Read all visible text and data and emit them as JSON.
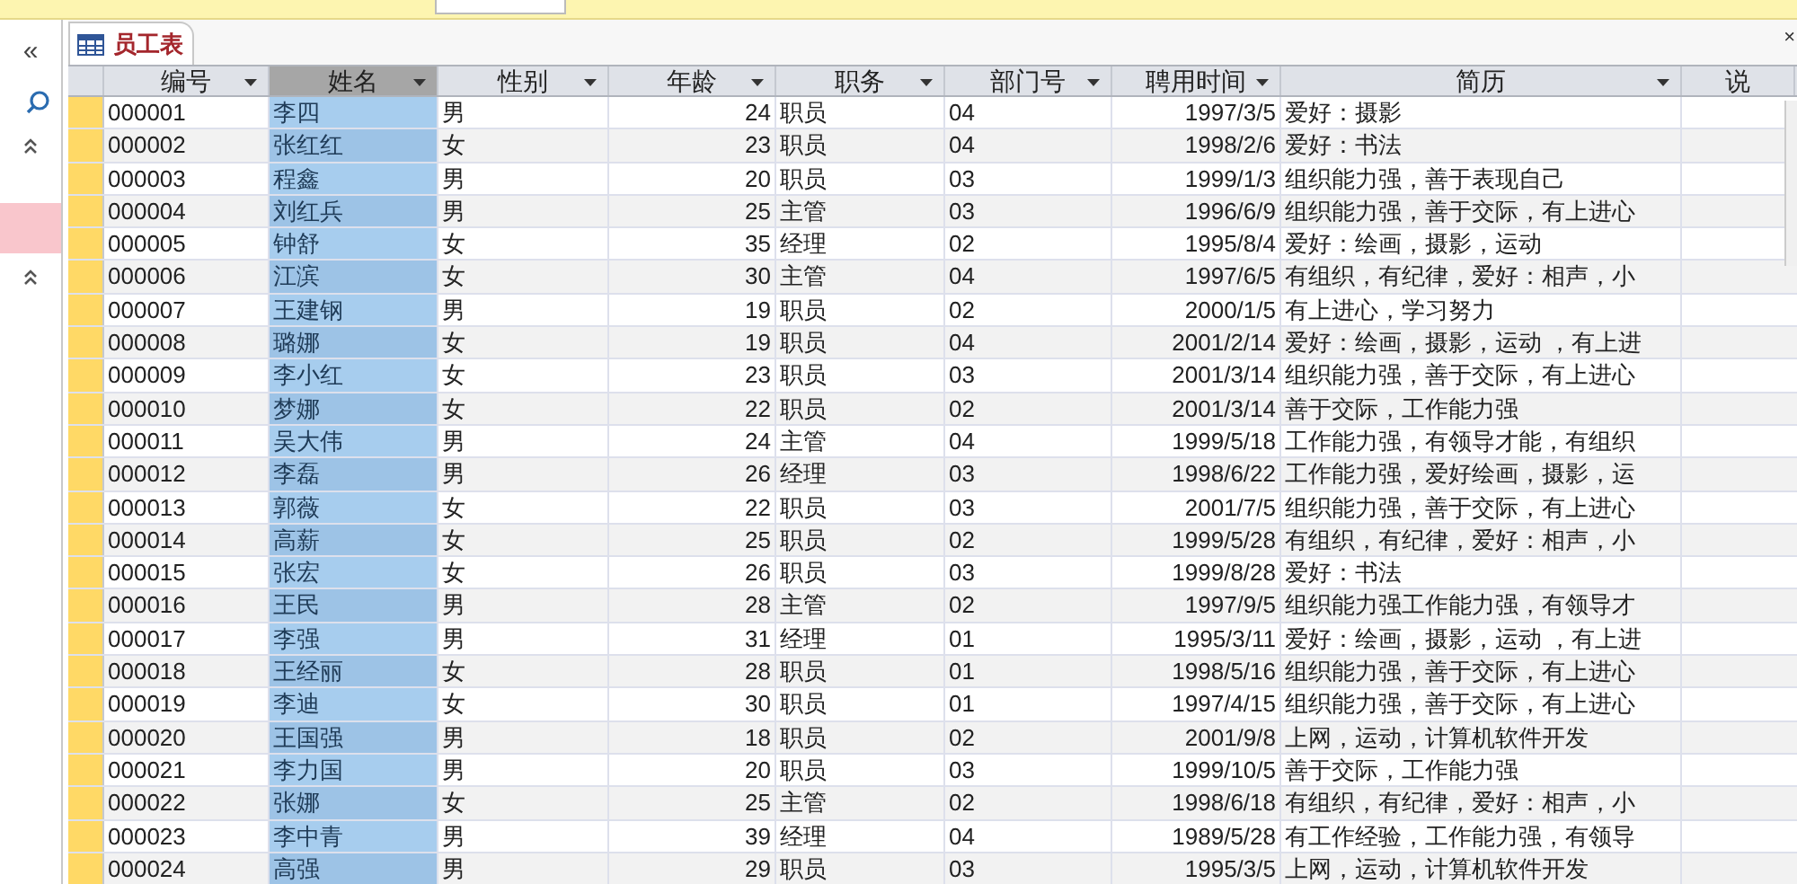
{
  "nav_pane": {
    "collapse_glyph": "«"
  },
  "close_glyph": "×",
  "tab": {
    "label": "员工表",
    "selected": true
  },
  "columns": [
    {
      "label": "编号",
      "kind": "text",
      "selected": false
    },
    {
      "label": "姓名",
      "kind": "text",
      "selected": true
    },
    {
      "label": "性别",
      "kind": "text",
      "selected": false
    },
    {
      "label": "年龄",
      "kind": "number",
      "selected": false
    },
    {
      "label": "职务",
      "kind": "text",
      "selected": false
    },
    {
      "label": "部门号",
      "kind": "text",
      "selected": false
    },
    {
      "label": "聘用时间",
      "kind": "number",
      "selected": false
    },
    {
      "label": "简历",
      "kind": "text",
      "selected": false
    },
    {
      "label": "说",
      "selected": false
    }
  ],
  "rows": [
    [
      "000001",
      "李四",
      "男",
      "24",
      "职员",
      "04",
      "1997/3/5",
      "爱好：摄影"
    ],
    [
      "000002",
      "张红红",
      "女",
      "23",
      "职员",
      "04",
      "1998/2/6",
      "爱好：书法"
    ],
    [
      "000003",
      "程鑫",
      "男",
      "20",
      "职员",
      "03",
      "1999/1/3",
      "组织能力强，善于表现自己"
    ],
    [
      "000004",
      "刘红兵",
      "男",
      "25",
      "主管",
      "03",
      "1996/6/9",
      "组织能力强，善于交际，有上进心"
    ],
    [
      "000005",
      "钟舒",
      "女",
      "35",
      "经理",
      "02",
      "1995/8/4",
      "爱好：绘画，摄影，运动"
    ],
    [
      "000006",
      "江滨",
      "女",
      "30",
      "主管",
      "04",
      "1997/6/5",
      "有组织，有纪律，爱好：相声，小"
    ],
    [
      "000007",
      "王建钢",
      "男",
      "19",
      "职员",
      "02",
      "2000/1/5",
      "有上进心，学习努力"
    ],
    [
      "000008",
      "璐娜",
      "女",
      "19",
      "职员",
      "04",
      "2001/2/14",
      "爱好：绘画，摄影，运动 ，有上进"
    ],
    [
      "000009",
      "李小红",
      "女",
      "23",
      "职员",
      "03",
      "2001/3/14",
      "组织能力强，善于交际，有上进心"
    ],
    [
      "000010",
      "梦娜",
      "女",
      "22",
      "职员",
      "02",
      "2001/3/14",
      "善于交际，工作能力强"
    ],
    [
      "000011",
      "吴大伟",
      "男",
      "24",
      "主管",
      "04",
      "1999/5/18",
      "工作能力强，有领导才能，有组织"
    ],
    [
      "000012",
      "李磊",
      "男",
      "26",
      "经理",
      "03",
      "1998/6/22",
      "工作能力强，爱好绘画，摄影，运"
    ],
    [
      "000013",
      "郭薇",
      "女",
      "22",
      "职员",
      "03",
      "2001/7/5",
      "组织能力强，善于交际，有上进心"
    ],
    [
      "000014",
      "高薪",
      "女",
      "25",
      "职员",
      "02",
      "1999/5/28",
      "有组织，有纪律，爱好：相声，小"
    ],
    [
      "000015",
      "张宏",
      "女",
      "26",
      "职员",
      "03",
      "1999/8/28",
      "爱好：书法"
    ],
    [
      "000016",
      "王民",
      "男",
      "28",
      "主管",
      "02",
      "1997/9/5",
      "组织能力强工作能力强，有领导才"
    ],
    [
      "000017",
      "李强",
      "男",
      "31",
      "经理",
      "01",
      "1995/3/11",
      "爱好：绘画，摄影，运动 ，有上进"
    ],
    [
      "000018",
      "王经丽",
      "女",
      "28",
      "职员",
      "01",
      "1998/5/16",
      "组织能力强，善于交际，有上进心"
    ],
    [
      "000019",
      "李迪",
      "女",
      "30",
      "职员",
      "01",
      "1997/4/15",
      "组织能力强，善于交际，有上进心"
    ],
    [
      "000020",
      "王国强",
      "男",
      "18",
      "职员",
      "02",
      "2001/9/8",
      "上网，运动，计算机软件开发"
    ],
    [
      "000021",
      "李力国",
      "男",
      "20",
      "职员",
      "03",
      "1999/10/5",
      "善于交际，工作能力强"
    ],
    [
      "000022",
      "张娜",
      "女",
      "25",
      "主管",
      "02",
      "1998/6/18",
      "有组织，有纪律，爱好：相声，小"
    ],
    [
      "000023",
      "李中青",
      "男",
      "39",
      "经理",
      "04",
      "1989/5/28",
      "有工作经验，工作能力强，有领导"
    ],
    [
      "000024",
      "高强",
      "男",
      "29",
      "职员",
      "03",
      "1995/3/5",
      "上网，运动，计算机软件开发"
    ]
  ]
}
